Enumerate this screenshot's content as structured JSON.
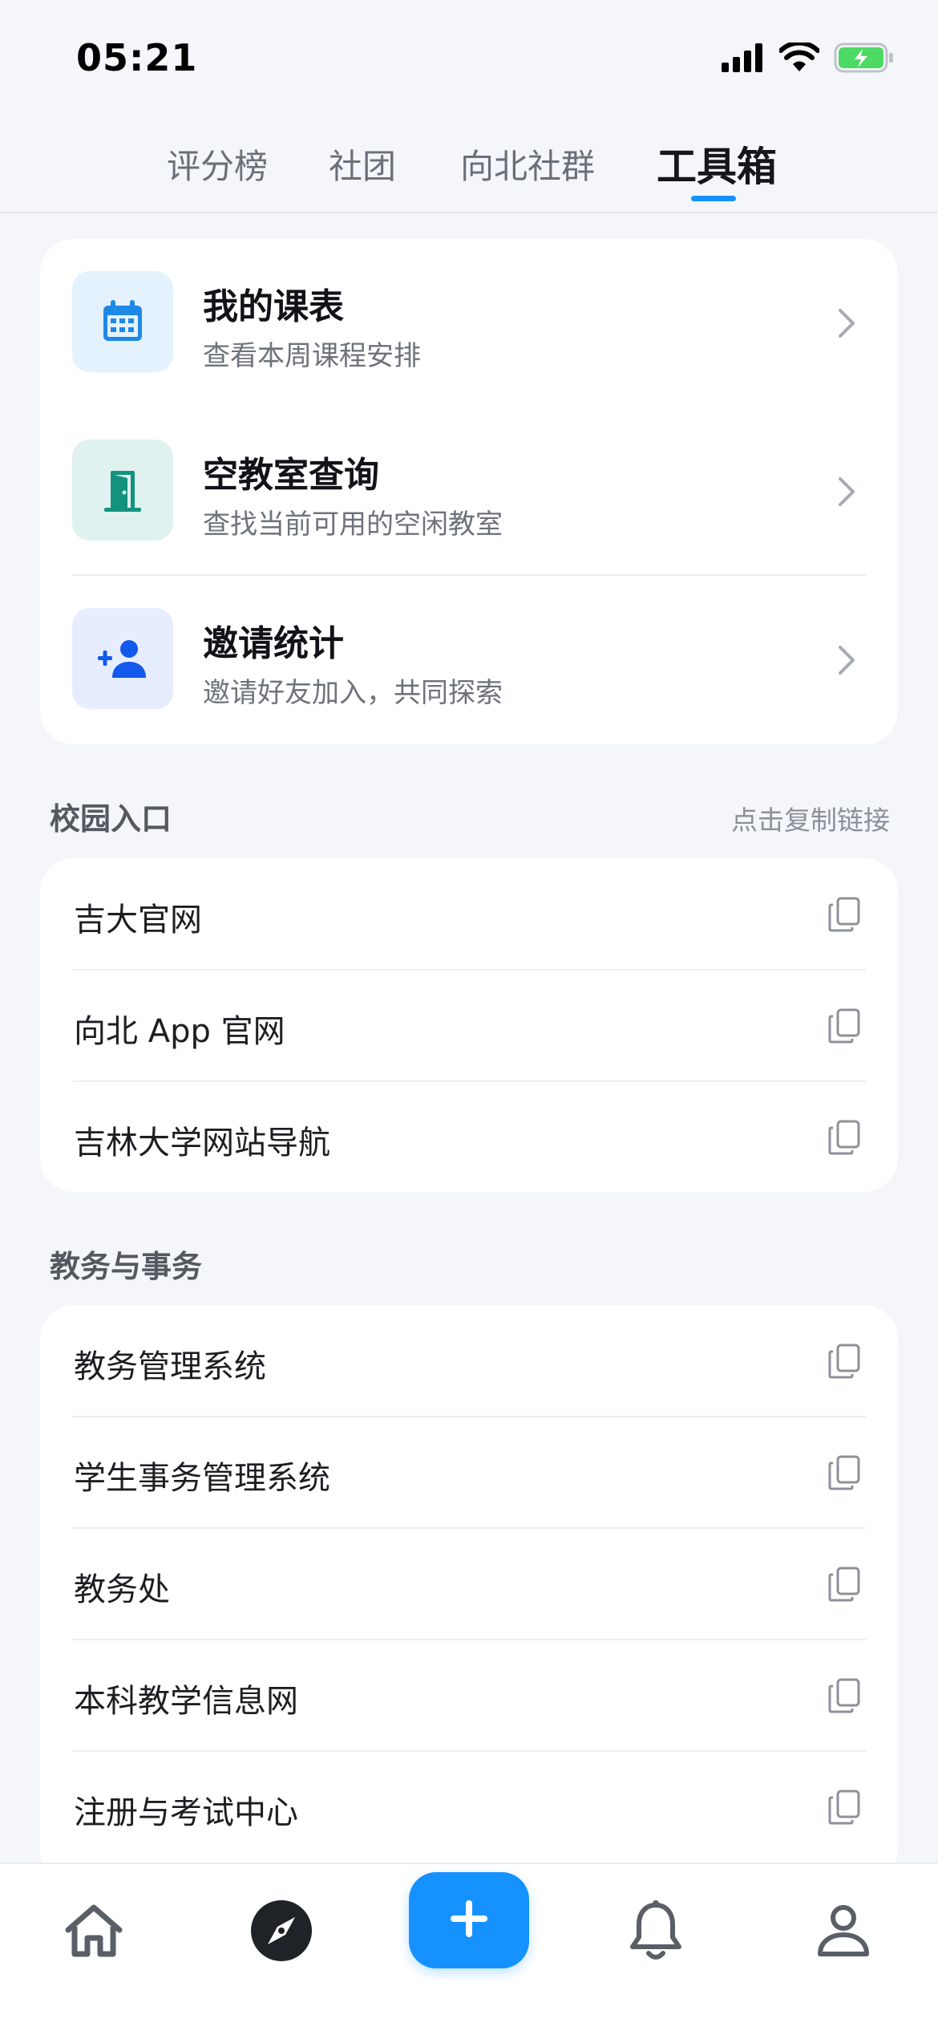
{
  "status_bar": {
    "time": "05:21"
  },
  "tabs": [
    {
      "label": "评分榜"
    },
    {
      "label": "社团"
    },
    {
      "label": "向北社群"
    },
    {
      "label": "工具箱"
    }
  ],
  "tools": [
    {
      "title": "我的课表",
      "subtitle": "查看本周课程安排",
      "icon": "calendar-icon"
    },
    {
      "title": "空教室查询",
      "subtitle": "查找当前可用的空闲教室",
      "icon": "door-icon"
    },
    {
      "title": "邀请统计",
      "subtitle": "邀请好友加入，共同探索",
      "icon": "add-person-icon"
    }
  ],
  "campus": {
    "title": "校园入口",
    "hint": "点击复制链接",
    "links": [
      {
        "label": "吉大官网"
      },
      {
        "label": "向北 App 官网"
      },
      {
        "label": "吉林大学网站导航"
      }
    ]
  },
  "academic": {
    "title": "教务与事务",
    "links": [
      {
        "label": "教务管理系统"
      },
      {
        "label": "学生事务管理系统"
      },
      {
        "label": "教务处"
      },
      {
        "label": "本科教学信息网"
      },
      {
        "label": "注册与考试中心"
      }
    ]
  },
  "colors": {
    "accent": "#1592ff",
    "calendar_bg": "#e3f2fd",
    "door_bg": "#e0f2ef",
    "person_bg": "#e5edff"
  },
  "bottom_nav": {
    "items": [
      "home-icon",
      "compass-icon",
      "plus-icon",
      "bell-icon",
      "person-icon"
    ]
  }
}
